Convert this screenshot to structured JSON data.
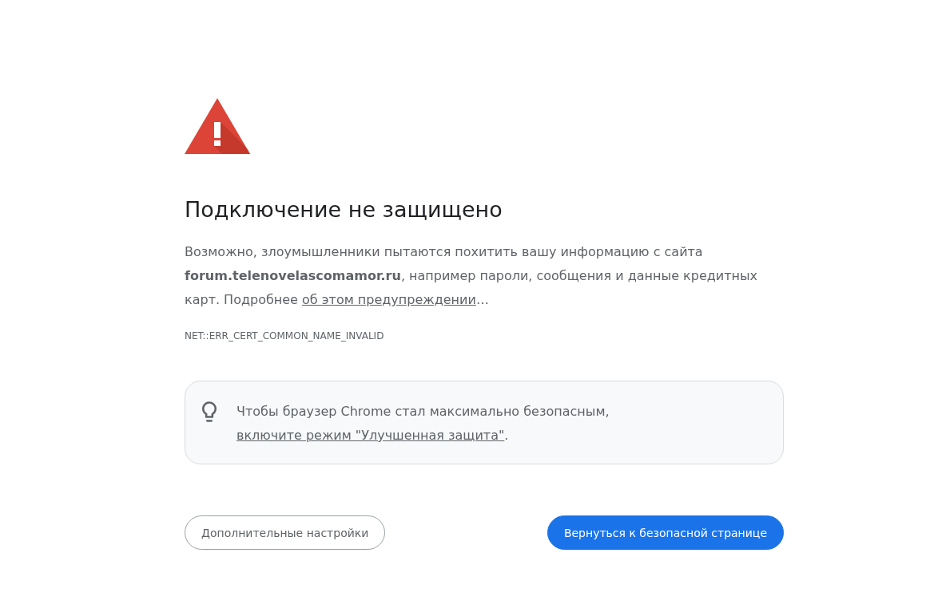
{
  "heading": "Подключение не защищено",
  "message": {
    "text": "Возможно, злоумышленники пытаются похитить вашу информацию с сайта **forum.telenovelascomamor.ru**, например пароли, сообщения и данные кредитных карт. Подробнее ",
    "link": "об этом предупреждении",
    "after": "…"
  },
  "error_code": "NET::ERR_CERT_COMMON_NAME_INVALID",
  "enhanced_protection": {
    "text": "Чтобы браузер Chrome стал максимально безопасным, ",
    "link": "включите режим \"Улучшенная защита\"",
    "after": "."
  },
  "buttons": [
    {
      "label": "Дополнительные настройки",
      "kind": "secondary"
    },
    {
      "label": "Вернуться к безопасной странице",
      "kind": "primary"
    }
  ]
}
